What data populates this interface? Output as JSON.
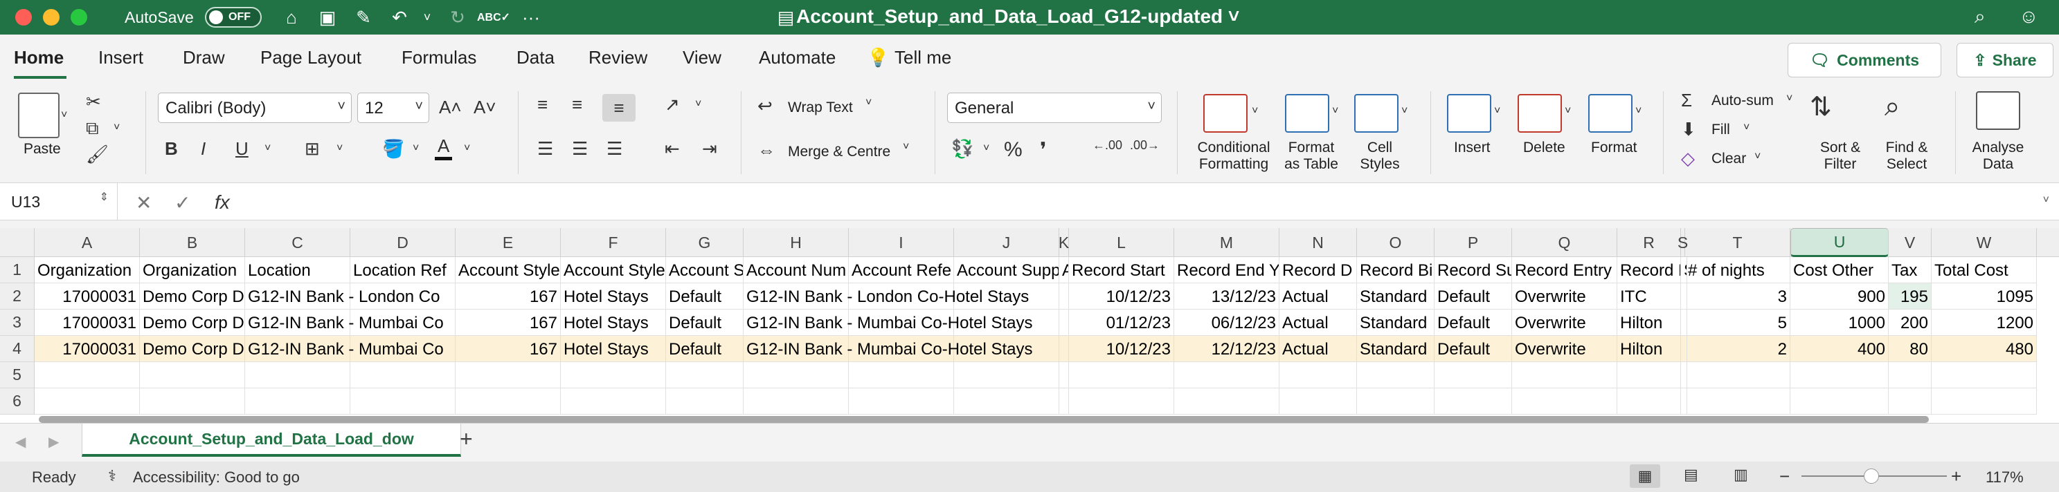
{
  "titlebar": {
    "autosave_label": "AutoSave",
    "autosave_state": "OFF",
    "doc_title": "Account_Setup_and_Data_Load_G12-updated ˅",
    "accent": "#217346"
  },
  "tabs": [
    "Home",
    "Insert",
    "Draw",
    "Page Layout",
    "Formulas",
    "Data",
    "Review",
    "View",
    "Automate",
    "Tell me"
  ],
  "actions": {
    "comments": "Comments",
    "share": "Share"
  },
  "ribbon": {
    "paste": "Paste",
    "font_name": "Calibri (Body)",
    "font_size": "12",
    "wrap_text": "Wrap Text",
    "merge_centre": "Merge & Centre",
    "number_format": "General",
    "conditional_formatting": [
      "Conditional",
      "Formatting"
    ],
    "format_as_table": [
      "Format",
      "as Table"
    ],
    "cell_styles": [
      "Cell",
      "Styles"
    ],
    "insert": "Insert",
    "delete": "Delete",
    "format": "Format",
    "autosum": "Auto-sum",
    "fill": "Fill",
    "clear": "Clear",
    "sort_filter": [
      "Sort &",
      "Filter"
    ],
    "find_select": [
      "Find &",
      "Select"
    ],
    "analyse_data": [
      "Analyse",
      "Data"
    ]
  },
  "formula_bar": {
    "name_box": "U13",
    "fx": "fx",
    "value": ""
  },
  "sheet": {
    "columns": [
      "A",
      "B",
      "C",
      "D",
      "E",
      "F",
      "G",
      "H",
      "I",
      "J",
      "K",
      "L",
      "M",
      "N",
      "O",
      "P",
      "Q",
      "R",
      "S",
      "T",
      "U",
      "V",
      "W"
    ],
    "selected_column": "U",
    "row_numbers": [
      "1",
      "2",
      "3",
      "4",
      "5",
      "6"
    ],
    "rows": [
      [
        "Organization",
        "Organization",
        "Location",
        "Location Ref",
        "Account Style",
        "Account Style",
        "Account S",
        "Account Num",
        "Account Refe",
        "Account Supp",
        "A",
        "Record Start",
        "Record End Y",
        "Record D",
        "Record Bil",
        "Record Su",
        "Record Entry",
        "Record F",
        "S",
        "# of nights",
        "Cost Other",
        "Tax",
        "Total Cost"
      ],
      [
        "17000031",
        "Demo Corp D",
        "G12-IN Bank - London Co",
        "",
        "167",
        "Hotel Stays",
        "Default",
        "G12-IN Bank - London Co-Hotel Stays",
        "",
        "",
        "",
        "10/12/23",
        "13/12/23",
        "Actual",
        "Standard",
        "Default",
        "Overwrite",
        "ITC",
        "",
        "3",
        "900",
        "195",
        "1095"
      ],
      [
        "17000031",
        "Demo Corp D",
        "G12-IN Bank - Mumbai Co",
        "",
        "167",
        "Hotel Stays",
        "Default",
        "G12-IN Bank - Mumbai Co-Hotel Stays",
        "",
        "",
        "",
        "01/12/23",
        "06/12/23",
        "Actual",
        "Standard",
        "Default",
        "Overwrite",
        "Hilton",
        "",
        "5",
        "1000",
        "200",
        "1200"
      ],
      [
        "17000031",
        "Demo Corp D",
        "G12-IN Bank - Mumbai Co",
        "",
        "167",
        "Hotel Stays",
        "Default",
        "G12-IN Bank - Mumbai Co-Hotel Stays",
        "",
        "",
        "",
        "10/12/23",
        "12/12/23",
        "Actual",
        "Standard",
        "Default",
        "Overwrite",
        "Hilton",
        "",
        "2",
        "400",
        "80",
        "480"
      ],
      [
        "",
        "",
        "",
        "",
        "",
        "",
        "",
        "",
        "",
        "",
        "",
        "",
        "",
        "",
        "",
        "",
        "",
        "",
        "",
        "",
        "",
        "",
        ""
      ],
      [
        "",
        "",
        "",
        "",
        "",
        "",
        "",
        "",
        "",
        "",
        "",
        "",
        "",
        "",
        "",
        "",
        "",
        "",
        "",
        "",
        "",
        "",
        ""
      ]
    ]
  },
  "sheet_tab": "Account_Setup_and_Data_Load_dow",
  "status": {
    "ready": "Ready",
    "accessibility": "Accessibility: Good to go",
    "zoom": "117%"
  }
}
